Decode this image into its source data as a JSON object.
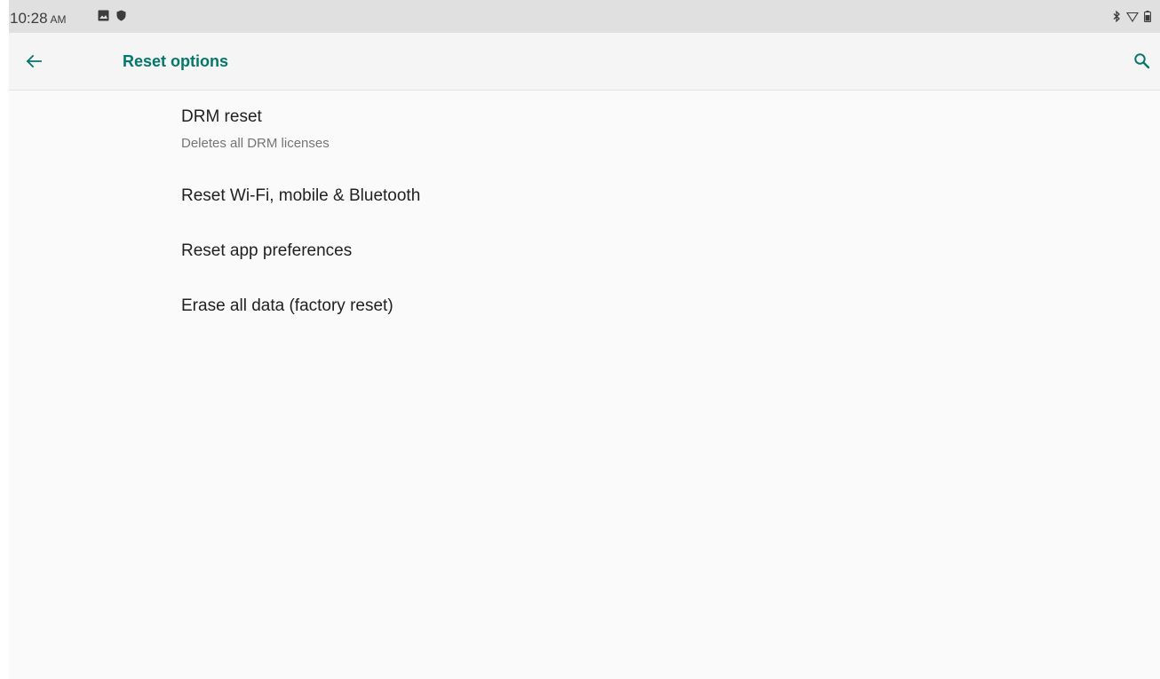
{
  "status_bar": {
    "time": "10:28",
    "ampm": "AM",
    "left_icons": [
      "image-icon",
      "shield-icon"
    ],
    "right_icons": [
      "bluetooth-icon",
      "wifi-icon",
      "battery-icon"
    ]
  },
  "app_bar": {
    "title": "Reset options",
    "back_icon": "arrow-back-icon",
    "search_icon": "search-icon",
    "accent_color": "#00796b"
  },
  "reset_options": [
    {
      "title": "DRM reset",
      "summary": "Deletes all DRM licenses"
    },
    {
      "title": "Reset Wi-Fi, mobile & Bluetooth"
    },
    {
      "title": "Reset app preferences"
    },
    {
      "title": "Erase all data (factory reset)"
    }
  ]
}
